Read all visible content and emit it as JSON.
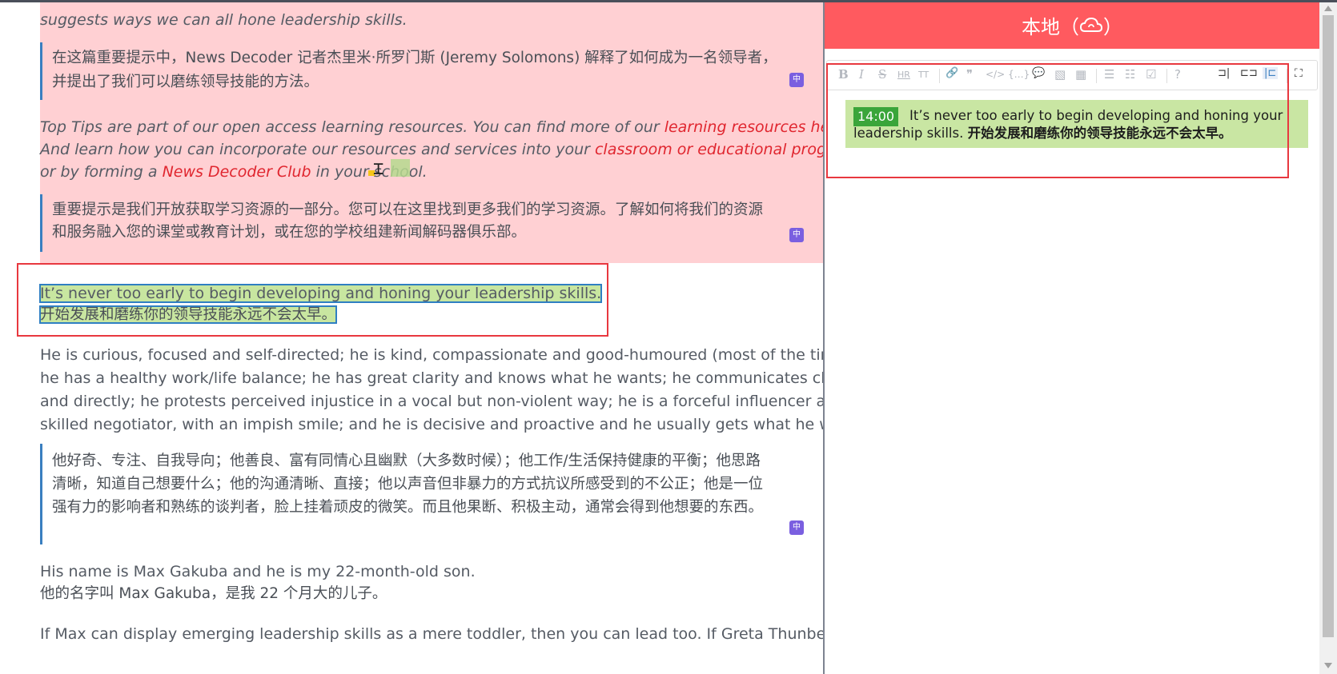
{
  "article": {
    "intro_tail": "suggests ways we can all hone leadership skills.",
    "intro_cn": [
      "在这篇重要提示中，News Decoder 记者杰里米·所罗门斯 (Jeremy Solomons) 解释了如何成为一名领导者，",
      "并提出了我们可以磨练领导技能的方法。"
    ],
    "tips": {
      "l1_a": "Top Tips are part of our open access learning resources. You can find more of our ",
      "l1_link": "learning resources here.",
      "l2_a": "And learn how you can incorporate our resources and services into your ",
      "l2_link": "classroom or educational program",
      "l3_a": "or by forming a ",
      "l3_link": "News Decoder Club",
      "l3_b": " in your school."
    },
    "tips_cn": [
      "重要提示是我们开放获取学习资源的一部分。您可以在这里找到更多我们的学习资源。了解如何将我们的资源",
      "和服务融入您的课堂或教育计划，或在您的学校组建新闻解码器俱乐部。"
    ],
    "highlight_en": "It’s never too early to begin developing and honing your leadership skills.",
    "highlight_cn": "开始发展和磨练你的领导技能永远不会太早。",
    "p1": [
      "He is curious, focused and self-directed; he is kind, compassionate and good-humoured (most of the time);",
      "he has a healthy work/life balance; he has great clarity and knows what he wants; he communicates clearly",
      "and directly; he protests perceived injustice in a vocal but non-violent way; he is a forceful influencer and",
      "skilled negotiator, with an impish smile; and he is decisive and proactive and he usually gets what he wants."
    ],
    "p1_cn": [
      "他好奇、专注、自我导向；他善良、富有同情心且幽默（大多数时候）；他工作/生活保持健康的平衡；他思路",
      "清晰，知道自己想要什么；他的沟通清晰、直接；他以声音但非暴力的方式抗议所感受到的不公正；他是一位",
      "强有力的影响者和熟练的谈判者，脸上挂着顽皮的微笑。而且他果断、积极主动，通常会得到他想要的东西。"
    ],
    "p2_en": "His name is Max Gakuba and he is my 22-month-old son.",
    "p2_cn": "他的名字叫 Max Gakuba，是我 22 个月大的儿子。",
    "p3": "If Max can display emerging leadership skills as a mere toddler, then you can lead too. If Greta Thunberg and",
    "translate_badge": "中"
  },
  "panel": {
    "title": "本地（",
    "title_close": "）",
    "cloud_icon": "cloud-sync-icon",
    "toolbar": {
      "bold": "B",
      "italic": "I",
      "strike": "S",
      "hr": "HR",
      "title": "TT",
      "link": "🔗",
      "quote": "❞",
      "code": "</>",
      "codeblock": "{…}",
      "comment": "💬",
      "image": "▧",
      "table": "▦",
      "ul": "☰",
      "ol": "☷",
      "task": "☑",
      "help": "?",
      "v1": "⊐|",
      "v2": "⊏⊐",
      "v3": "|⊏",
      "fullscreen": "⛶"
    },
    "note": {
      "time": "14:00",
      "text_en": "It’s never too early to begin developing and honing your leadership skills.",
      "text_cn": "开始发展和磨练你的领导技能永远不会太早。"
    }
  },
  "colors": {
    "accent": "#ff5a5f",
    "highlight": "#c9e6a3",
    "link": "#e0262f",
    "pink_bg": "#ffd0d3"
  }
}
